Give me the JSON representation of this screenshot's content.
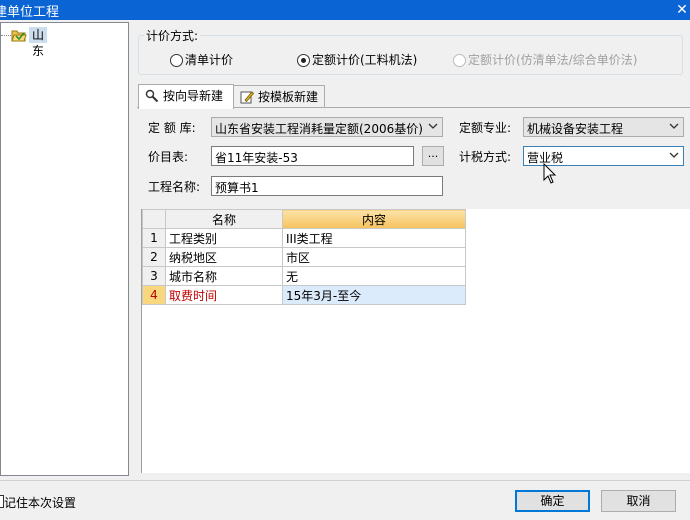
{
  "window": {
    "title": "建单位工程",
    "close_glyph": "✕"
  },
  "tree": {
    "root_label": "山东"
  },
  "pricing_group": {
    "label": "计价方式:",
    "options": [
      {
        "label": "清单计价",
        "selected": false,
        "disabled": false
      },
      {
        "label": "定额计价(工料机法)",
        "selected": true,
        "disabled": false
      },
      {
        "label": "定额计价(仿清单法/综合单价法)",
        "selected": false,
        "disabled": true
      }
    ]
  },
  "tabs": [
    {
      "label": "按向导新建",
      "active": true,
      "icon": "wizard-icon"
    },
    {
      "label": "按模板新建",
      "active": false,
      "icon": "template-icon"
    }
  ],
  "form": {
    "quota_lib_label": "定 额 库:",
    "quota_lib_value": "山东省安装工程消耗量定额(2006基价)",
    "quota_major_label": "定额专业:",
    "quota_major_value": "机械设备安装工程",
    "price_table_label": "价目表:",
    "price_table_value": "省11年安装-53",
    "browse_label": "...",
    "tax_method_label": "计税方式:",
    "tax_method_value": "营业税",
    "project_name_label": "工程名称:",
    "project_name_value": "预算书1"
  },
  "grid": {
    "headers": [
      "名称",
      "内容"
    ],
    "rows": [
      {
        "num": "1",
        "name": "工程类别",
        "value": "III类工程",
        "highlight": false
      },
      {
        "num": "2",
        "name": "纳税地区",
        "value": "市区",
        "highlight": false
      },
      {
        "num": "3",
        "name": "城市名称",
        "value": "无",
        "highlight": false
      },
      {
        "num": "4",
        "name": "取费时间",
        "value": "15年3月-至今",
        "highlight": true
      }
    ]
  },
  "footer": {
    "remember_label": "记住本次设置",
    "ok_label": "确定",
    "cancel_label": "取消"
  },
  "colors": {
    "titlebar": "#0a64d4",
    "accent": "#0078d7",
    "highlight_text": "#c00000"
  }
}
